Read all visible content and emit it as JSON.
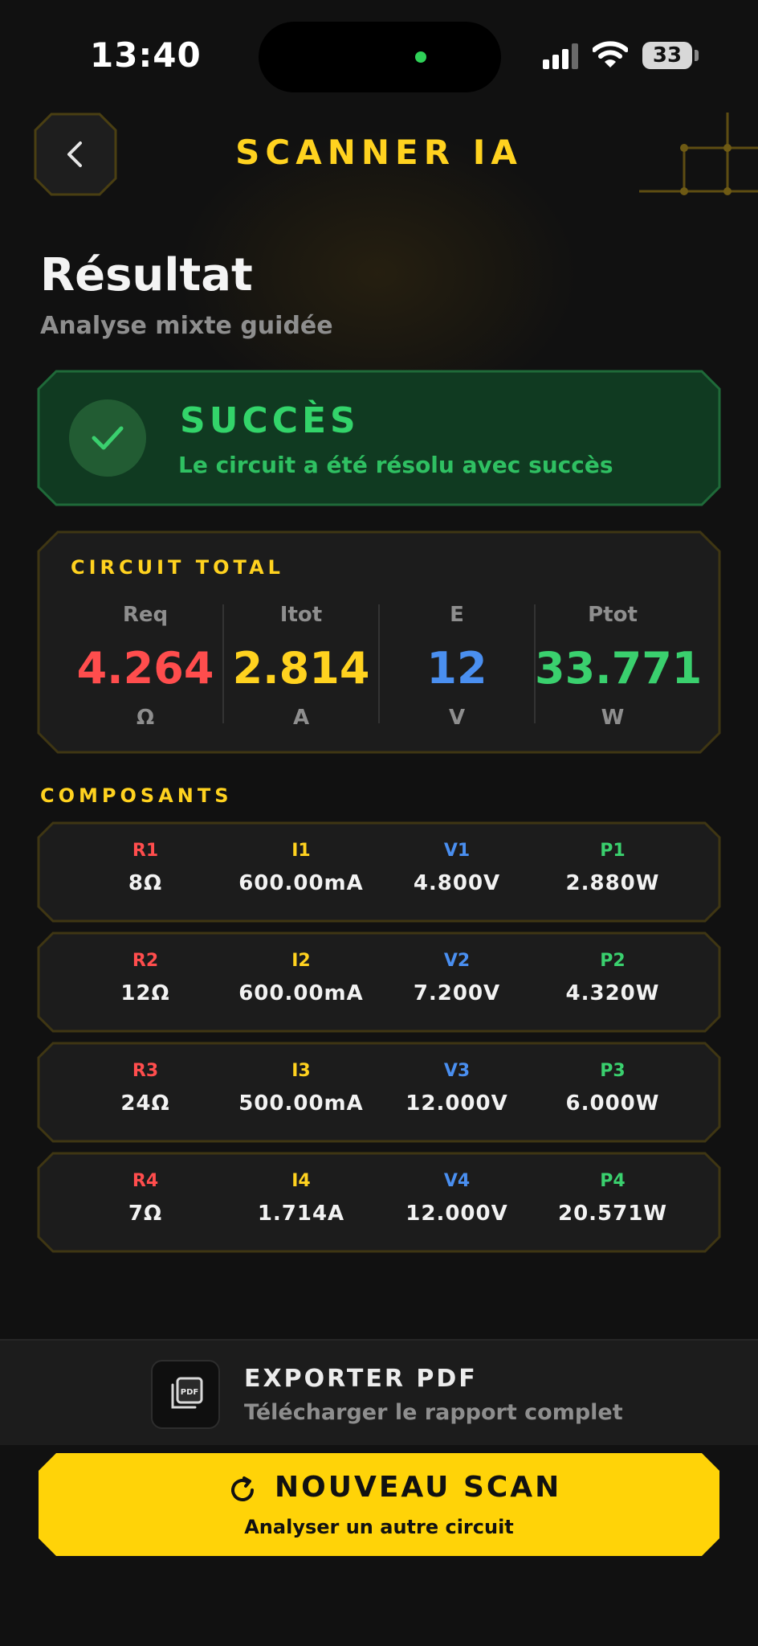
{
  "status_bar": {
    "time": "13:40",
    "battery": "33"
  },
  "header": {
    "title": "SCANNER IA"
  },
  "page": {
    "title": "Résultat",
    "subtitle": "Analyse mixte guidée"
  },
  "success": {
    "title": "SUCCÈS",
    "message": "Le circuit a été résolu avec succès"
  },
  "total": {
    "label": "CIRCUIT TOTAL",
    "metrics": [
      {
        "name": "Req",
        "value": "4.264",
        "unit": "Ω",
        "color": "#ff4d4d"
      },
      {
        "name": "Itot",
        "value": "2.814",
        "unit": "A",
        "color": "#ffd21f"
      },
      {
        "name": "E",
        "value": "12",
        "unit": "V",
        "color": "#4a8ff0"
      },
      {
        "name": "Ptot",
        "value": "33.771",
        "unit": "W",
        "color": "#3ad06e"
      }
    ]
  },
  "components": {
    "label": "COMPOSANTS",
    "rows": [
      {
        "r": {
          "name": "R1",
          "value": "8Ω"
        },
        "i": {
          "name": "I1",
          "value": "600.00mA"
        },
        "v": {
          "name": "V1",
          "value": "4.800V"
        },
        "p": {
          "name": "P1",
          "value": "2.880W"
        }
      },
      {
        "r": {
          "name": "R2",
          "value": "12Ω"
        },
        "i": {
          "name": "I2",
          "value": "600.00mA"
        },
        "v": {
          "name": "V2",
          "value": "7.200V"
        },
        "p": {
          "name": "P2",
          "value": "4.320W"
        }
      },
      {
        "r": {
          "name": "R3",
          "value": "24Ω"
        },
        "i": {
          "name": "I3",
          "value": "500.00mA"
        },
        "v": {
          "name": "V3",
          "value": "12.000V"
        },
        "p": {
          "name": "P3",
          "value": "6.000W"
        }
      },
      {
        "r": {
          "name": "R4",
          "value": "7Ω"
        },
        "i": {
          "name": "I4",
          "value": "1.714A"
        },
        "v": {
          "name": "V4",
          "value": "12.000V"
        },
        "p": {
          "name": "P4",
          "value": "20.571W"
        }
      }
    ]
  },
  "export": {
    "title": "EXPORTER PDF",
    "subtitle": "Télécharger le rapport complet"
  },
  "new_scan": {
    "title": "NOUVEAU SCAN",
    "subtitle": "Analyser un autre circuit"
  },
  "colors": {
    "accent": "#ffd21f",
    "success": "#33d46a",
    "resistance": "#ff4d4d",
    "current": "#ffd21f",
    "voltage": "#4a8ff0",
    "power": "#3ad06e"
  },
  "icons": [
    "back-chevron-icon",
    "circuit-decoration-icon",
    "checkmark-icon",
    "pdf-icon",
    "refresh-icon",
    "signal-icon",
    "wifi-icon",
    "battery-icon"
  ]
}
